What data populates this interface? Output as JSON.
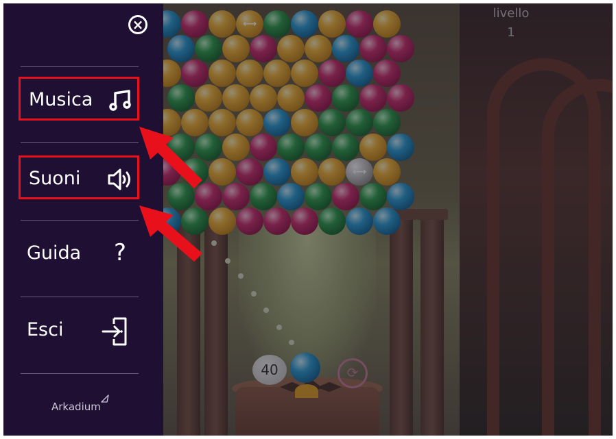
{
  "menu": {
    "close_icon": "close-circle-icon",
    "items": [
      {
        "label": "Musica",
        "icon": "music-note-icon",
        "highlighted": true
      },
      {
        "label": "Suoni",
        "icon": "speaker-icon",
        "highlighted": true
      },
      {
        "label": "Guida",
        "icon": "question-mark-icon",
        "highlighted": false
      },
      {
        "label": "Esci",
        "icon": "exit-icon",
        "highlighted": false
      }
    ],
    "guide_glyph": "?",
    "brand": "Arkadium"
  },
  "game": {
    "level_label": "livello",
    "level_value": "1",
    "shots_remaining": "40",
    "swap_glyph": "⟳"
  },
  "colors": {
    "sidebar_bg": "#1e0f33",
    "highlight_border": "#e8101a",
    "annotation_arrow": "#e8101a"
  }
}
